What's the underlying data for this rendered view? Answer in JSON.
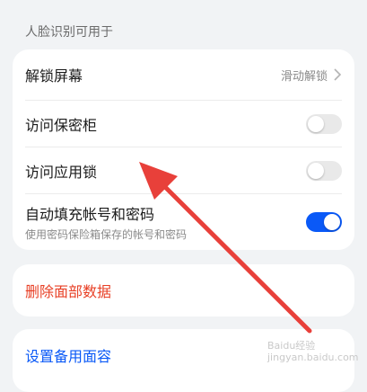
{
  "section": {
    "title": "人脸识别可用于"
  },
  "main": {
    "unlock": {
      "label": "解锁屏幕",
      "value": "滑动解锁"
    },
    "vault": {
      "label": "访问保密柜",
      "enabled": false
    },
    "applock": {
      "label": "访问应用锁",
      "enabled": false
    },
    "autofill": {
      "label": "自动填充帐号和密码",
      "subtitle": "使用密码保险箱保存的帐号和密码",
      "enabled": true
    }
  },
  "delete": {
    "label": "删除面部数据"
  },
  "backup": {
    "label": "设置备用面容"
  },
  "watermark": {
    "line1": "Baidu经验",
    "line2": "jingyan.baidu.com"
  },
  "colors": {
    "accent": "#0a59f7",
    "danger": "#e84026",
    "annotation_arrow": "#e8403a"
  }
}
